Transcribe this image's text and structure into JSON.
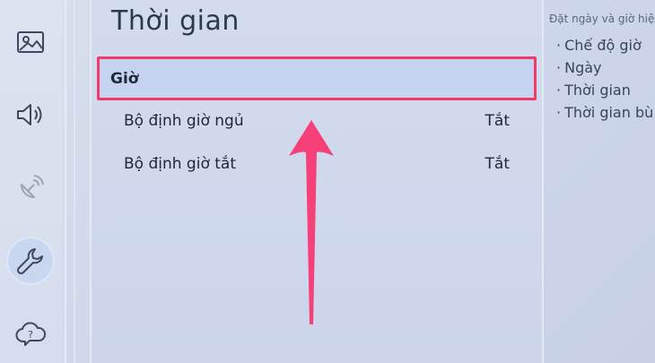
{
  "sidebar": {
    "icons": [
      {
        "name": "picture-icon"
      },
      {
        "name": "sound-icon"
      },
      {
        "name": "broadcast-icon"
      },
      {
        "name": "support-tools-icon",
        "active": true
      },
      {
        "name": "help-cloud-icon"
      }
    ]
  },
  "menu": {
    "title": "Thời gian",
    "items": [
      {
        "label": "Giờ",
        "value": ""
      },
      {
        "label": "Bộ định giờ ngủ",
        "value": "Tắt"
      },
      {
        "label": "Bộ định giờ tắt",
        "value": "Tắt"
      }
    ]
  },
  "help": {
    "description": "Đặt ngày và giờ hiện",
    "items": [
      "Chế độ giờ",
      "Ngày",
      "Thời gian",
      "Thời gian bù"
    ],
    "bullet": "·"
  },
  "colors": {
    "highlight_border": "#f23a6a",
    "arrow": "#f5407a",
    "selected_bg": "#c4d3f0"
  }
}
